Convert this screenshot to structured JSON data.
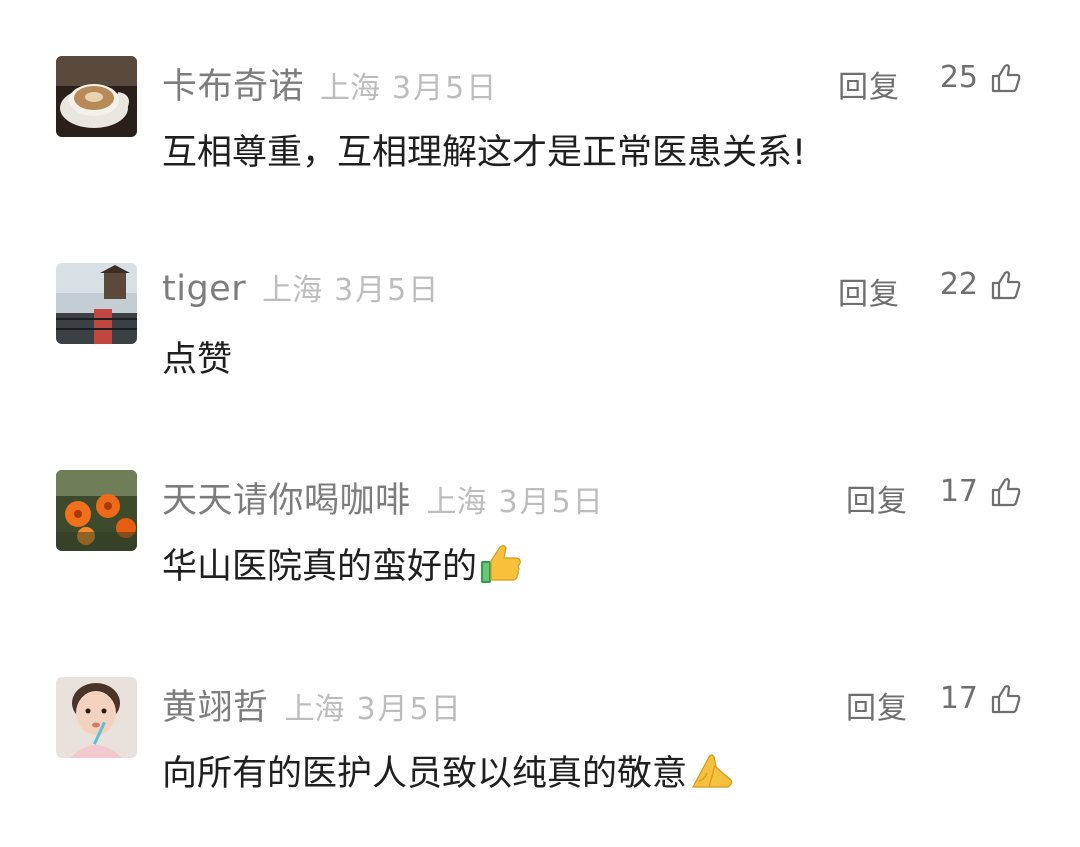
{
  "comments": [
    {
      "username": "卡布奇诺",
      "location": "上海",
      "date": "3月5日",
      "reply_label": "回复",
      "likes": "25",
      "content": "互相尊重，互相理解这才是正常医患关系!",
      "avatar": "coffee-cup-avatar",
      "emoji": ""
    },
    {
      "username": "tiger",
      "location": "上海",
      "date": "3月5日",
      "reply_label": "回复",
      "likes": "22",
      "content": "点赞",
      "avatar": "lakeside-pavilion-avatar",
      "emoji": ""
    },
    {
      "username": "天天请你喝咖啡",
      "location": "上海",
      "date": "3月5日",
      "reply_label": "回复",
      "likes": "17",
      "content": "华山医院真的蛮好的",
      "avatar": "orange-lily-avatar",
      "emoji": "thumbs-up-emoji"
    },
    {
      "username": "黄翊哲",
      "location": "上海",
      "date": "3月5日",
      "reply_label": "回复",
      "likes": "17",
      "content": "向所有的医护人员致以纯真的敬意",
      "avatar": "toddler-photo-avatar",
      "emoji": "folded-hands-emoji"
    }
  ],
  "colors": {
    "username": "#7d7d7d",
    "meta": "#bdbdbd",
    "action": "#6f6f6f",
    "content": "#1f1f1f"
  }
}
